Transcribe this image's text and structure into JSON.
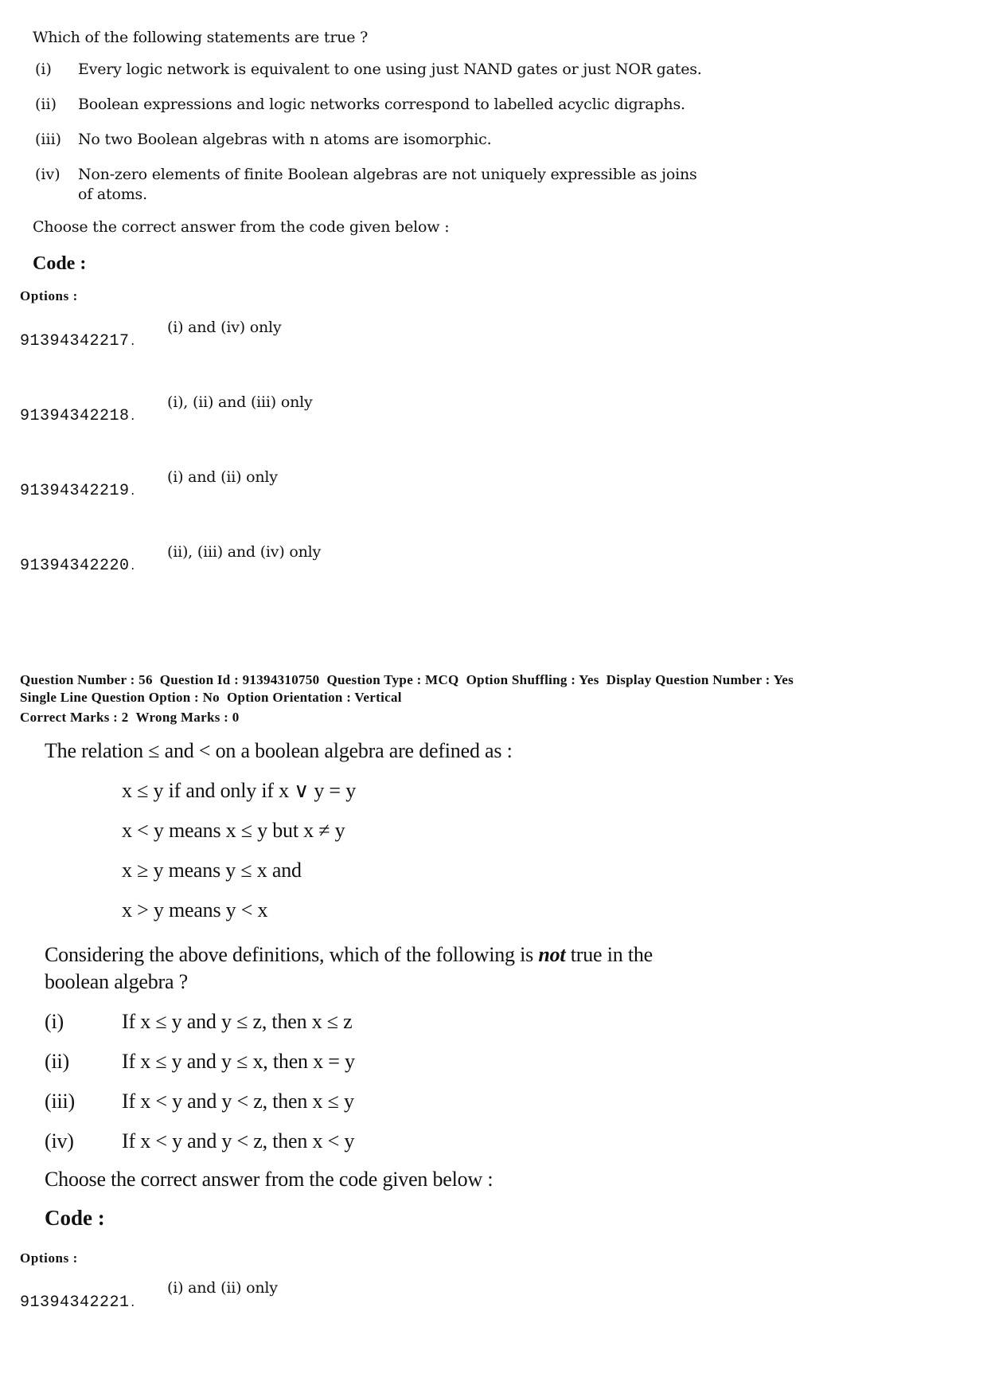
{
  "question_55": {
    "prompt": "Which of the following statements are true ?",
    "statements": [
      {
        "num": "(i)",
        "text": "Every logic network is equivalent to one using just NAND gates or just NOR gates."
      },
      {
        "num": "(ii)",
        "text": "Boolean expressions and logic networks correspond to labelled acyclic digraphs."
      },
      {
        "num": "(iii)",
        "text": "No two Boolean algebras with n atoms are isomorphic."
      },
      {
        "num": "(iv)",
        "text": "Non-zero elements of finite Boolean algebras are not uniquely expressible as joins",
        "text_cont": "of atoms."
      }
    ],
    "instruction": "Choose the correct answer from the code given below :",
    "code_label": "Code :",
    "options_label": "Options :",
    "options": [
      {
        "id": "91394342217",
        "text": "(i) and (iv) only"
      },
      {
        "id": "91394342218",
        "text": "(i), (ii) and (iii) only"
      },
      {
        "id": "91394342219",
        "text": "(i) and (ii) only"
      },
      {
        "id": "91394342220",
        "text": "(ii), (iii) and (iv) only"
      }
    ]
  },
  "question_56": {
    "meta": {
      "question_number_label": "Question Number :",
      "question_number": "56",
      "question_id_label": "Question Id :",
      "question_id": "91394310750",
      "question_type_label": "Question Type :",
      "question_type": "MCQ",
      "option_shuffling_label": "Option Shuffling :",
      "option_shuffling": "Yes",
      "display_question_number_label": "Display Question Number :",
      "display_question_number": "Yes",
      "single_line_label": "Single Line Question Option :",
      "single_line": "No",
      "option_orientation_label": "Option Orientation :",
      "option_orientation": "Vertical",
      "correct_marks_label": "Correct Marks :",
      "correct_marks": "2",
      "wrong_marks_label": "Wrong Marks :",
      "wrong_marks": "0"
    },
    "intro": "The relation ≤ and < on a boolean algebra are defined as :",
    "definitions": [
      "x ≤ y if and only if x ∨ y = y",
      "x < y means x ≤ y but x ≠ y",
      "x ≥ y means y ≤ x and",
      "x > y means y < x"
    ],
    "prompt_before": "Considering the above definitions, which of the following is ",
    "prompt_emphasis": "not",
    "prompt_after": " true in the",
    "prompt_line2": "boolean algebra ?",
    "statements": [
      {
        "num": "(i)",
        "text": "If x ≤ y and y ≤ z, then x ≤ z"
      },
      {
        "num": "(ii)",
        "text": "If x ≤ y and y ≤ x, then x = y"
      },
      {
        "num": "(iii)",
        "text": "If x < y and y < z, then x ≤ y"
      },
      {
        "num": "(iv)",
        "text": "If x < y and y < z, then x < y"
      }
    ],
    "instruction": "Choose the correct answer from the code given below :",
    "code_label": "Code :",
    "options_label": "Options :",
    "options": [
      {
        "id": "91394342221",
        "text": "(i) and (ii) only"
      }
    ]
  }
}
